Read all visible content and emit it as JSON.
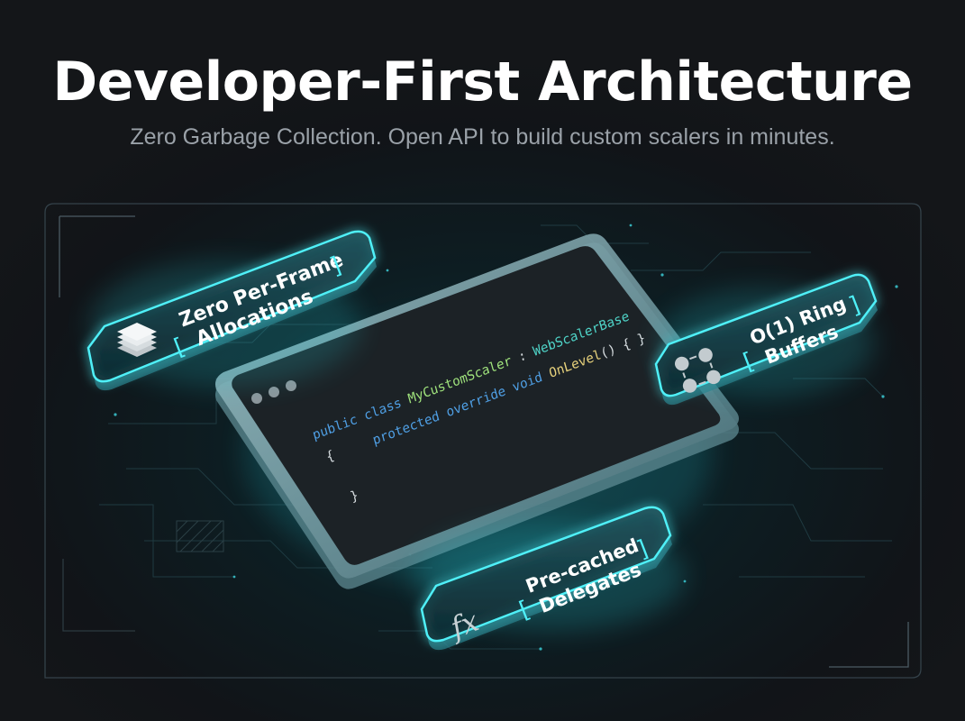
{
  "header": {
    "title": "Developer-First Architecture",
    "subtitle": "Zero Garbage Collection. Open API to build custom scalers in minutes."
  },
  "code": {
    "line1": {
      "kw1": "public",
      "kw2": "class",
      "type": "MyCustomScaler",
      "sep": ":",
      "base": "WebScalerBase"
    },
    "line2": {
      "brace": "{"
    },
    "line3": {
      "kw1": "protected",
      "kw2": "override",
      "kw3": "void",
      "method": "OnLevel",
      "rest": "() { }"
    },
    "line4": {
      "brace": "}"
    }
  },
  "badges": {
    "allocations": {
      "line1": "Zero Per-Frame",
      "line2": "Allocations",
      "icon": "stack-layers-icon"
    },
    "ring": {
      "line1": "O(1) Ring",
      "line2": "Buffers",
      "icon": "ring-buffer-icon"
    },
    "delegates": {
      "line1": "Pre-cached",
      "line2": "Delegates",
      "icon": "function-fx-icon",
      "glyph": "fx"
    }
  },
  "colors": {
    "accent": "#36e3ee",
    "keyword": "#4f9fe4",
    "type": "#9fe27c",
    "base": "#4fd4c8",
    "method": "#e7d27c"
  }
}
